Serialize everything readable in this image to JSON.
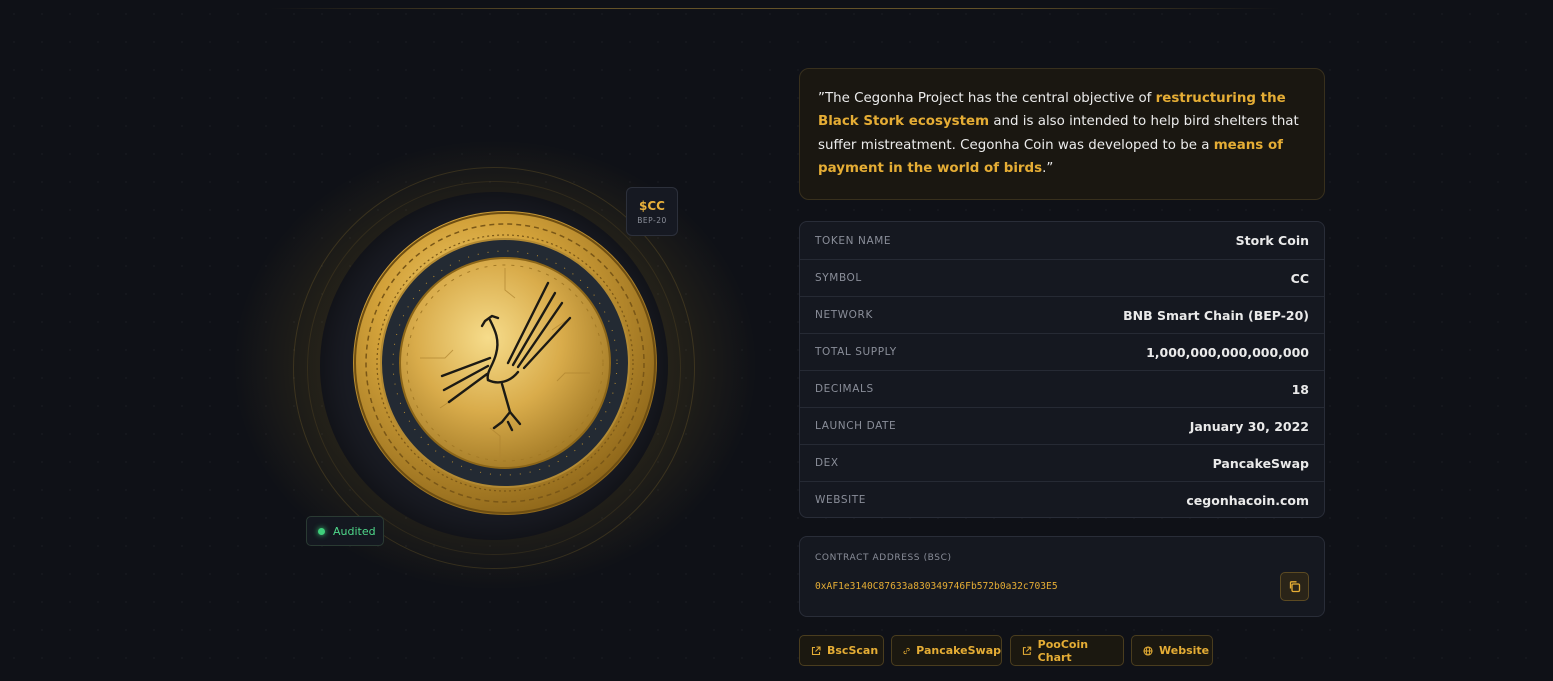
{
  "coin": {
    "symbol_badge": "$CC",
    "network_badge": "BEP-20",
    "audited_label": "Audited"
  },
  "quote": {
    "open_mark": "”",
    "part1": "The Cegonha Project has the central objective of ",
    "highlight1": "restructuring the Black Stork ecosystem",
    "part2": " and is also intended to help bird shelters that suffer mistreatment. Cegonha Coin was developed to be a ",
    "highlight2": "means of payment in the world of birds",
    "close_mark": ".”"
  },
  "token_table": [
    {
      "label": "TOKEN NAME",
      "value": "Stork Coin"
    },
    {
      "label": "SYMBOL",
      "value": "CC"
    },
    {
      "label": "NETWORK",
      "value": "BNB Smart Chain (BEP-20)"
    },
    {
      "label": "TOTAL SUPPLY",
      "value": "1,000,000,000,000,000"
    },
    {
      "label": "DECIMALS",
      "value": "18"
    },
    {
      "label": "LAUNCH DATE",
      "value": "January 30, 2022"
    },
    {
      "label": "DEX",
      "value": "PancakeSwap"
    },
    {
      "label": "WEBSITE",
      "value": "cegonhacoin.com"
    }
  ],
  "contract": {
    "label": "CONTRACT ADDRESS (BSC)",
    "address": "0xAF1e3140C87633a830349746Fb572b0a32c703E5",
    "copy_icon": "copy-icon"
  },
  "links": [
    {
      "label": "BscScan",
      "icon": "external-link-icon"
    },
    {
      "label": "PancakeSwap",
      "icon": "link-icon"
    },
    {
      "label": "PooCoin Chart",
      "icon": "external-link-icon"
    },
    {
      "label": "Website",
      "icon": "globe-icon"
    }
  ],
  "colors": {
    "background": "#0f1117",
    "accent_gold": "#e5ad35",
    "audited_green": "#3fcf7b",
    "card": "#151820"
  }
}
